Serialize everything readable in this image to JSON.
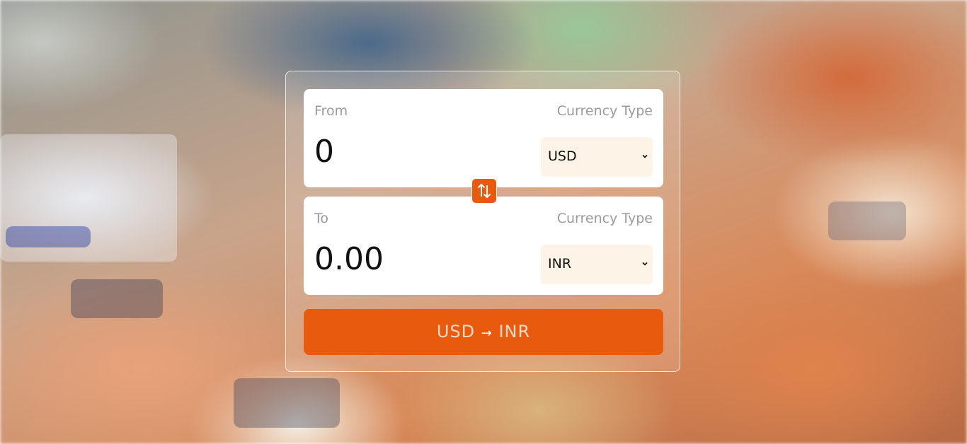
{
  "converter": {
    "from": {
      "label": "From",
      "type_label": "Currency Type",
      "amount": "0",
      "currency": "USD"
    },
    "to": {
      "label": "To",
      "type_label": "Currency Type",
      "amount": "0.00",
      "currency": "INR"
    },
    "swap_icon": "swap-vertical-arrows-icon",
    "convert_button": {
      "from_code": "USD",
      "arrow": "→",
      "to_code": "INR"
    }
  },
  "colors": {
    "accent": "#e85a0e",
    "panel": "#ffffff",
    "select_bg": "#fdf3e6",
    "muted_text": "#9a9a9a"
  }
}
